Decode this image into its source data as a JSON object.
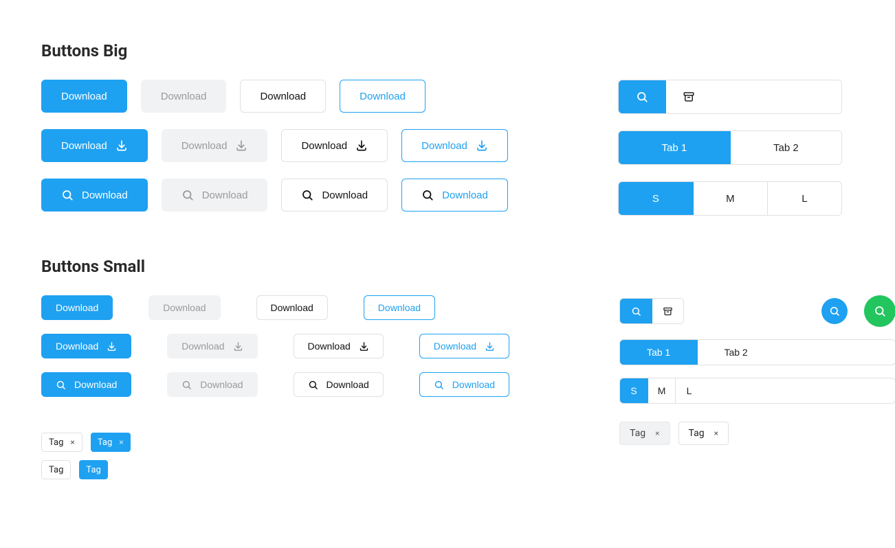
{
  "sections": {
    "big": {
      "title": "Buttons Big"
    },
    "small": {
      "title": "Buttons Small"
    }
  },
  "buttonLabel": "Download",
  "tabs": {
    "0": "Tab 1",
    "1": "Tab 2"
  },
  "sizes": {
    "0": "S",
    "1": "M",
    "2": "L"
  },
  "tag": {
    "label": "Tag"
  },
  "colors": {
    "primary": "#1ea1f1",
    "secondaryBg": "#f1f2f4",
    "secondaryText": "#9a9a9a",
    "border": "#e0e0e0",
    "green": "#22c55e"
  }
}
